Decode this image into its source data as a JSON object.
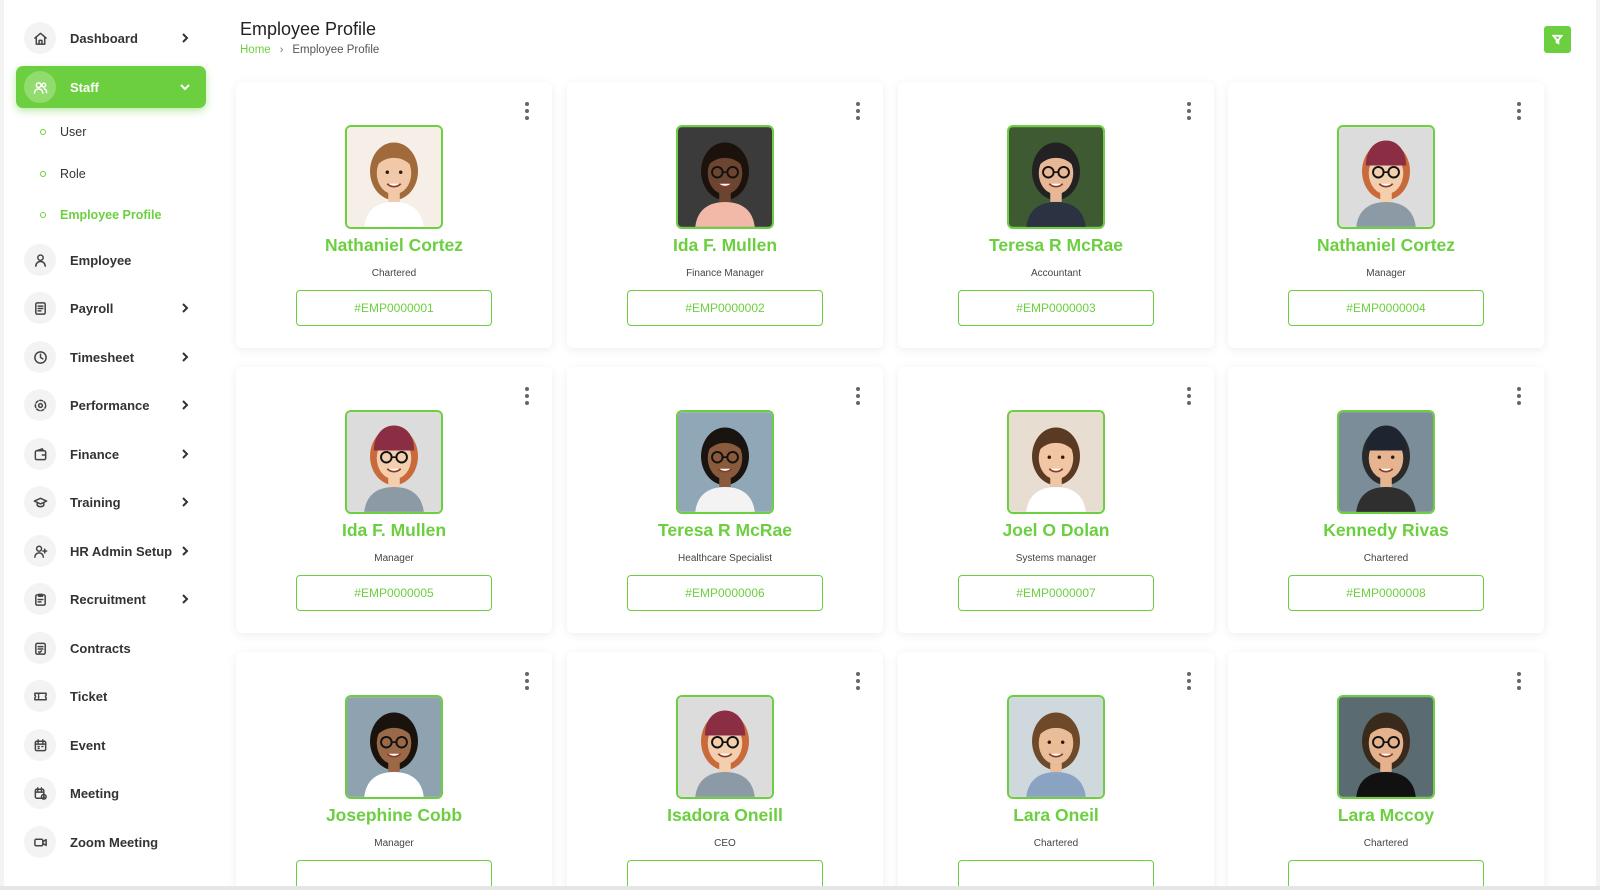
{
  "header": {
    "title": "Employee Profile",
    "breadcrumb": {
      "home": "Home",
      "current": "Employee Profile"
    }
  },
  "colors": {
    "accent": "#6ccf3f",
    "text": "#222222"
  },
  "sidebar": {
    "items": [
      {
        "label": "Dashboard",
        "icon": "home-icon",
        "chevron": "right"
      },
      {
        "label": "Staff",
        "icon": "users-icon",
        "chevron": "down",
        "active": true
      },
      {
        "label": "Employee",
        "icon": "user-icon"
      },
      {
        "label": "Payroll",
        "icon": "document-icon",
        "chevron": "right"
      },
      {
        "label": "Timesheet",
        "icon": "clock-icon",
        "chevron": "right"
      },
      {
        "label": "Performance",
        "icon": "target-icon",
        "chevron": "right"
      },
      {
        "label": "Finance",
        "icon": "wallet-icon",
        "chevron": "right"
      },
      {
        "label": "Training",
        "icon": "graduation-cap-icon",
        "chevron": "right"
      },
      {
        "label": "HR Admin Setup",
        "icon": "user-plus-icon",
        "chevron": "right"
      },
      {
        "label": "Recruitment",
        "icon": "clipboard-icon",
        "chevron": "right"
      },
      {
        "label": "Contracts",
        "icon": "contract-icon"
      },
      {
        "label": "Ticket",
        "icon": "ticket-icon"
      },
      {
        "label": "Event",
        "icon": "calendar-icon"
      },
      {
        "label": "Meeting",
        "icon": "calendar-clock-icon"
      },
      {
        "label": "Zoom Meeting",
        "icon": "video-icon"
      }
    ],
    "staff_sub": [
      {
        "label": "User"
      },
      {
        "label": "Role"
      },
      {
        "label": "Employee Profile",
        "current": true
      }
    ]
  },
  "employees": [
    {
      "name": "Nathaniel Cortez",
      "role": "Chartered",
      "id": "#EMP0000001"
    },
    {
      "name": "Ida F. Mullen",
      "role": "Finance Manager",
      "id": "#EMP0000002"
    },
    {
      "name": "Teresa R McRae",
      "role": "Accountant",
      "id": "#EMP0000003"
    },
    {
      "name": "Nathaniel Cortez",
      "role": "Manager",
      "id": "#EMP0000004"
    },
    {
      "name": "Ida F. Mullen",
      "role": "Manager",
      "id": "#EMP0000005"
    },
    {
      "name": "Teresa R McRae",
      "role": "Healthcare Specialist",
      "id": "#EMP0000006"
    },
    {
      "name": "Joel O Dolan",
      "role": "Systems manager",
      "id": "#EMP0000007"
    },
    {
      "name": "Kennedy Rivas",
      "role": "Chartered",
      "id": "#EMP0000008"
    },
    {
      "name": "Josephine Cobb",
      "role": "Manager",
      "id": ""
    },
    {
      "name": "Isadora Oneill",
      "role": "CEO",
      "id": ""
    },
    {
      "name": "Lara Oneil",
      "role": "Chartered",
      "id": ""
    },
    {
      "name": "Lara Mccoy",
      "role": "Chartered",
      "id": ""
    }
  ]
}
